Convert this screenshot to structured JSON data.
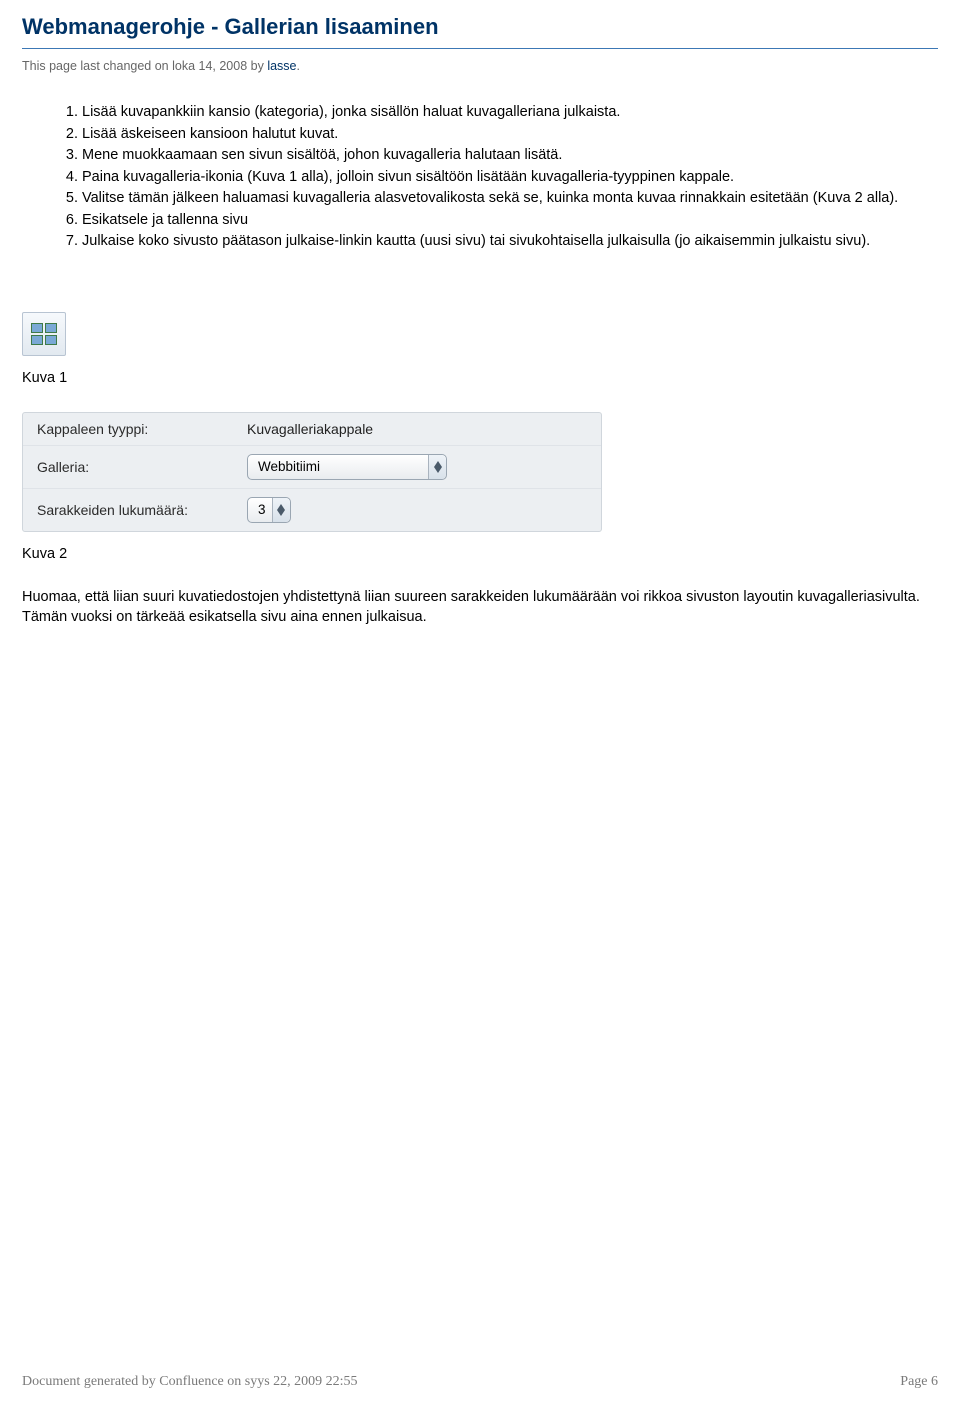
{
  "title": "Webmanagerohje - Gallerian lisaaminen",
  "meta": {
    "prefix": "This page last changed on loka 14, 2008 by ",
    "author": "lasse",
    "suffix": "."
  },
  "steps": [
    "Lisää kuvapankkiin kansio (kategoria), jonka sisällön haluat kuvagalleriana julkaista.",
    "Lisää äskeiseen kansioon halutut kuvat.",
    "Mene muokkaamaan sen sivun sisältöä, johon kuvagalleria halutaan lisätä.",
    "Paina kuvagalleria-ikonia (Kuva 1 alla), jolloin sivun sisältöön lisätään kuvagalleria-tyyppinen kappale.",
    "Valitse tämän jälkeen haluamasi kuvagalleria alasvetovalikosta sekä se, kuinka monta kuvaa rinnakkain esitetään (Kuva 2 alla).",
    "Esikatsele ja tallenna sivu",
    "Julkaise koko sivusto päätason julkaise-linkin kautta (uusi sivu) tai sivukohtaisella julkaisulla (jo aikaisemmin julkaistu sivu)."
  ],
  "captions": {
    "kuva1": "Kuva 1",
    "kuva2": "Kuva 2"
  },
  "form": {
    "rows": [
      {
        "label": "Kappaleen tyyppi:",
        "value": "Kuvagalleriakappale"
      },
      {
        "label": "Galleria:",
        "select": "Webbitiimi"
      },
      {
        "label": "Sarakkeiden lukumäärä:",
        "select": "3"
      }
    ]
  },
  "note": "Huomaa, että liian suuri kuvatiedostojen yhdistettynä liian suureen sarakkeiden lukumäärään voi rikkoa sivuston layoutin kuvagalleriasivulta. Tämän vuoksi on tärkeää esikatsella sivu aina ennen julkaisua.",
  "footer": {
    "left": "Document generated by Confluence on syys 22, 2009 22:55",
    "right": "Page 6"
  }
}
